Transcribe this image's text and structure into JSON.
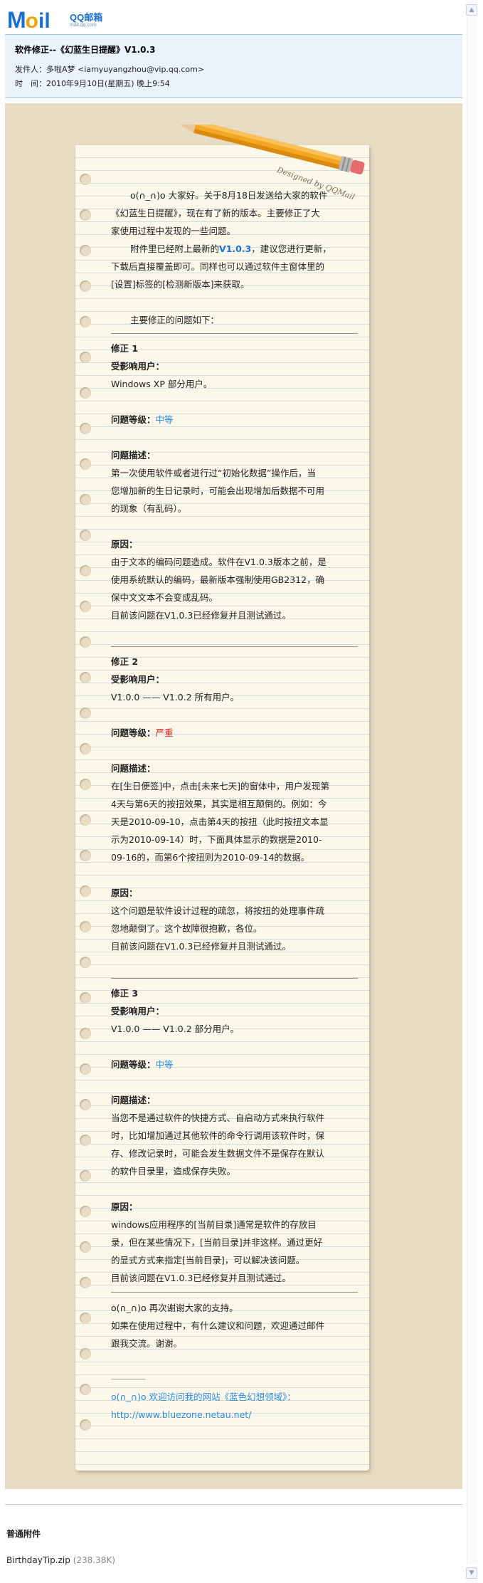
{
  "logo": {
    "text_m": "M",
    "text_o": "o",
    "text_il": "il",
    "brand": "QQ邮箱",
    "domain": "mail.qq.com"
  },
  "header": {
    "subject": "软件修正--《幻蓝生日提醒》V1.0.3",
    "sender": "发件人：多啦A梦  <iamyuyangzhou@vip.qq.com>",
    "time": "时　间：2010年9月10日(星期五) 晚上9:54"
  },
  "stationery": {
    "designed_by": "Designed by QQMail"
  },
  "body": {
    "intro1_a": "o(∩_∩)o 大家好。关于8月18日发送给大家的软件",
    "intro1_b": "《幻蓝生日提醒》，现在有了新的版本。主要修正了大",
    "intro1_c": "家使用过程中发现的一些问题。",
    "intro2_a_pre": "附件里已经附上最新的",
    "intro2_a_ver": "V1.0.3",
    "intro2_a_post": "，建议您进行更新，",
    "intro2_b": "下载后直接覆盖即可。同样也可以通过软件主窗体里的",
    "intro2_c": "[设置]标签的[检测新版本]来获取。",
    "main_issues": "主要修正的问题如下：",
    "fixes": [
      {
        "title": "修正 1",
        "users_label": "受影响用户：",
        "users": "Windows XP   部分用户。",
        "level_label": "问题等级：",
        "level": "中等",
        "desc_label": "问题描述：",
        "desc": [
          "第一次使用软件或者进行过“初始化数据”操作后，当",
          "您增加新的生日记录时，可能会出现增加后数据不可用",
          "的现象（有乱码）。"
        ],
        "cause_label": "原因：",
        "cause": [
          "由于文本的编码问题造成。软件在V1.0.3版本之前，是",
          "使用系统默认的编码，最新版本强制使用GB2312，确",
          "保中文文本不会变成乱码。",
          "目前该问题在V1.0.3已经修复并且测试通过。"
        ]
      },
      {
        "title": "修正 2",
        "users_label": "受影响用户：",
        "users": "V1.0.0 —— V1.0.2   所有用户。",
        "level_label": "问题等级：",
        "level": "严重",
        "desc_label": "问题描述：",
        "desc": [
          "在[生日便签]中，点击[未来七天]的窗体中，用户发现第",
          "4天与第6天的按扭效果，其实是相互颠倒的。例如：今",
          "天是2010-09-10，点击第4天的按扭（此时按扭文本显",
          "示为2010-09-14）时，下面具体显示的数据是2010-",
          "09-16的，而第6个按扭则为2010-09-14的数据。"
        ],
        "cause_label": "原因：",
        "cause": [
          "这个问题是软件设计过程的疏忽，将按扭的处理事件疏",
          "忽地颠倒了。这个故障很抱歉，各位。",
          "目前该问题在V1.0.3已经修复并且测试通过。"
        ]
      },
      {
        "title": "修正 3",
        "users_label": "受影响用户：",
        "users": "V1.0.0 —— V1.0.2   部分用户。",
        "level_label": "问题等级：",
        "level": "中等",
        "desc_label": "问题描述：",
        "desc": [
          "当您不是通过软件的快捷方式、自启动方式来执行软件",
          "时，比如增加通过其他软件的命令行调用该软件时，保",
          "存、修改记录时，可能会发生数据文件不是保存在默认",
          "的软件目录里，造成保存失败。"
        ],
        "cause_label": "原因：",
        "cause": [
          "windows应用程序的[当前目录]通常是软件的存放目",
          "录，但在某些情况下，[当前目录]并非这样。通过更好",
          "的显式方式来指定[当前目录]，可以解决该问题。",
          "目前该问题在V1.0.3已经修复并且测试通过。"
        ]
      }
    ],
    "thanks": "o(∩_∩)o 再次谢谢大家的支持。",
    "contact_a": "如果在使用过程中，有什么建议和问题，欢迎通过邮件",
    "contact_b": "跟我交流。谢谢。",
    "sig_line": "——————",
    "website_a": "o(∩_∩)o  欢迎访问我的网站《蓝色幻想领域》：",
    "website_url": "http://www.bluezone.netau.net/"
  },
  "attachments": {
    "title": "普通附件",
    "files": [
      {
        "name": "BirthdayTip.zip",
        "size": "(238.38K)"
      }
    ]
  },
  "colors": {
    "brand_blue": "#1a6fd0",
    "medium": "#2d8be0",
    "severe": "#e02020",
    "paper": "#fbf8ea",
    "beige": "#e8dcc5"
  }
}
